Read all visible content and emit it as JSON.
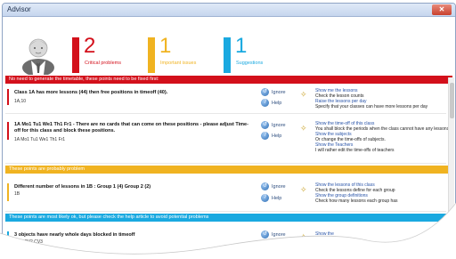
{
  "window": {
    "title": "Advisor",
    "close_glyph": "✕"
  },
  "stats": [
    {
      "number": "2",
      "label": "Critical problems",
      "color": "#d3101b"
    },
    {
      "number": "1",
      "label": "Important issues",
      "color": "#f0b321"
    },
    {
      "number": "1",
      "label": "Suggestions",
      "color": "#1aa9e0"
    }
  ],
  "sections": {
    "critical": "No need to generate the timetable, these points need to be fixed first:",
    "important": "These points are probably problem",
    "suggestions": "These points are most likely ok, but please check the help article to avoid potential problems"
  },
  "actions": {
    "ignore": "Ignore",
    "help": "Help"
  },
  "items": [
    {
      "desc": "Class 1A has more lessons (44) then free positions in timeoff (40).",
      "sub": "1A,10",
      "solutions": [
        {
          "link": "Show me the lessons",
          "text": "Check the lesson counts"
        },
        {
          "link": "Raise the lessons per day",
          "text": "Specify that your classes can have more lessons per day"
        }
      ]
    },
    {
      "desc": "1A Mo1 Tu1 We1 Th1 Fr1 - There are no cards that can come on these positions - please adjust Time-off for this class and block these positions.",
      "sub": "1A Mo1 Tu1 We1 Th1 Fr1",
      "solutions": [
        {
          "link": "Show the time-off of this class",
          "text": "You shall block the periods when the class cannot have any lessons."
        },
        {
          "link": "Show the subjects",
          "text": "Or change the time-offs of subjects."
        },
        {
          "link": "Show the Teachers",
          "text": "I will rather edit the time-offs of teachers"
        }
      ]
    },
    {
      "desc": "Different number of lessons in 1B : Group 1 (4) Group 2 (2)",
      "sub": "1B",
      "solutions": [
        {
          "link": "Show the lessons of this class",
          "text": "Check the lessons define for each group"
        },
        {
          "link": "Show the group definitions",
          "text": "Check how many lessons each group has"
        }
      ]
    },
    {
      "desc": "3 objects have nearly whole days blocked in timeoff",
      "sub": "CV1,CV2,CV3",
      "solutions": [
        {
          "link": "Show the",
          "text": ""
        }
      ]
    }
  ]
}
